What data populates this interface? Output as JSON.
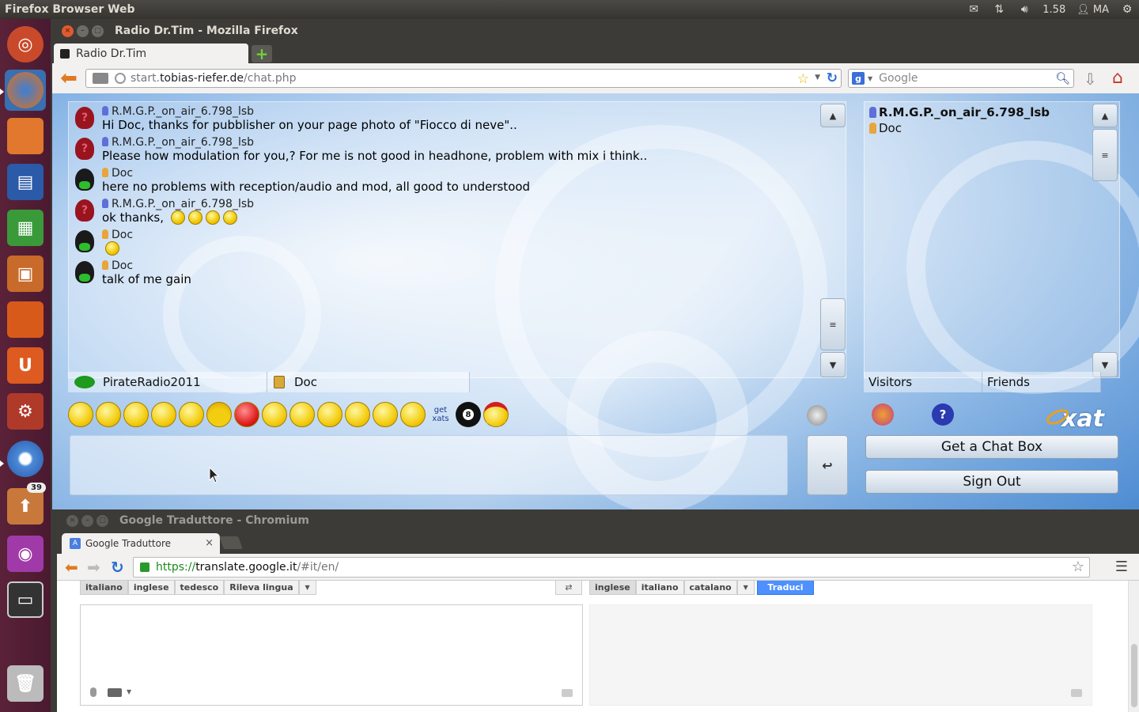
{
  "top_panel": {
    "app_title": "Firefox Browser Web",
    "clock": "1.58",
    "user": "MA",
    "icons": [
      "mail-icon",
      "network-icon",
      "volume-icon",
      "user-icon",
      "gear-icon"
    ]
  },
  "launcher": {
    "items": [
      "ubuntu-dash",
      "firefox",
      "files",
      "libreoffice-writer",
      "libreoffice-calc",
      "libreoffice-impress",
      "software-center",
      "ubuntu-one",
      "system-settings",
      "chromium",
      "update-manager",
      "webcam-app",
      "workspace-switcher",
      "trash"
    ],
    "update_badge": "39"
  },
  "firefox": {
    "window_title": "Radio Dr.Tim - Mozilla Firefox",
    "tab_title": "Radio Dr.Tim",
    "url_prefix": "start.",
    "url_domain": "tobias-riefer.de",
    "url_path": "/chat.php",
    "search_placeholder": "Google"
  },
  "chat": {
    "messages": [
      {
        "user": "R.M.G.P._on_air_6.798_lsb",
        "text": "Hi Doc, thanks for pubblisher on your page photo of \"Fiocco di neve\"..",
        "avatar": "question"
      },
      {
        "user": "R.M.G.P._on_air_6.798_lsb",
        "text": "Please how modulation for you,? For me is not good in headhone,  problem with mix i think..",
        "avatar": "question"
      },
      {
        "user": "Doc",
        "text": "here no problems with reception/audio and mod, all good to understood",
        "avatar": "ninja"
      },
      {
        "user": "R.M.G.P._on_air_6.798_lsb",
        "text": "ok thanks,",
        "avatar": "question"
      },
      {
        "user": "Doc",
        "text": "",
        "avatar": "ninja"
      },
      {
        "user": "Doc",
        "text": "talk of me gain",
        "avatar": "ninja"
      }
    ],
    "tabs": {
      "main": "PirateRadio2011",
      "private": "Doc"
    },
    "smileys_getxats_line1": "get",
    "smileys_getxats_line2": "xats",
    "ball8": "8",
    "users": [
      "R.M.G.P._on_air_6.798_lsb",
      "Doc"
    ],
    "user_tabs": {
      "visitors": "Visitors",
      "friends": "Friends"
    },
    "logo": "xat",
    "help_icon": "?",
    "get_chat_box": "Get a Chat Box",
    "sign_out": "Sign Out",
    "send_icon": "↩"
  },
  "chromium": {
    "window_title": "Google Traduttore - Chromium",
    "tab_title": "Google Traduttore",
    "url_scheme": "https://",
    "url_host": "translate.google.it",
    "url_path": "/#it/en/",
    "source_langs": [
      "italiano",
      "inglese",
      "tedesco",
      "Rileva lingua"
    ],
    "target_langs": [
      "inglese",
      "italiano",
      "catalano"
    ],
    "translate_button": "Traduci"
  }
}
